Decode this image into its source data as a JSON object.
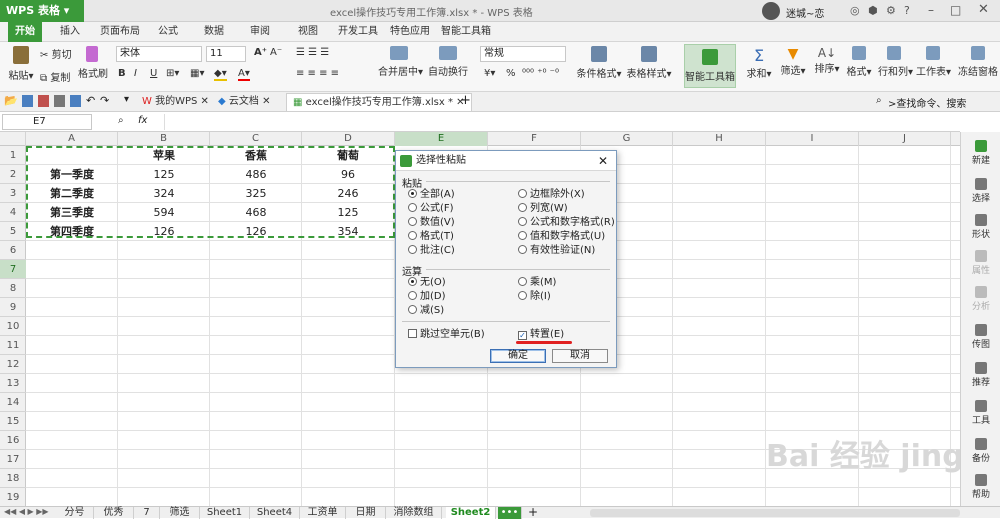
{
  "titlebar": {
    "app_menu": "WPS 表格",
    "window_title": "excel操作技巧专用工作簿.xlsx * - WPS 表格",
    "user": "迷城~恋"
  },
  "ribbon_tabs": [
    "开始",
    "插入",
    "页面布局",
    "公式",
    "数据",
    "审阅",
    "视图",
    "开发工具",
    "特色应用",
    "智能工具箱"
  ],
  "ribbon": {
    "paste": "粘贴",
    "cut": "剪切",
    "copy": "复制",
    "format_painter": "格式刷",
    "font_name": "宋体",
    "font_size": "11",
    "bold": "B",
    "italic": "I",
    "underline": "U",
    "merge_center": "合并居中",
    "wrap": "自动换行",
    "number_format": "常规",
    "percent": "%",
    "conditional_format": "条件格式",
    "table_style": "表格样式",
    "smart_toolbox": "智能工具箱",
    "sum": "求和",
    "filter": "筛选",
    "sort": "排序",
    "format": "格式",
    "row_col": "行和列",
    "worksheet": "工作表",
    "freeze": "冻结窗格"
  },
  "doc_tabs": {
    "my_wps": "我的WPS",
    "cloud": "云文档",
    "file": "excel操作技巧专用工作簿.xlsx *",
    "search": ">查找命令、搜索"
  },
  "formula_bar": {
    "name_box": "E7",
    "fx": "fx"
  },
  "columns": [
    "A",
    "B",
    "C",
    "D",
    "E",
    "F",
    "G",
    "H",
    "I",
    "J"
  ],
  "rows": [
    "1",
    "2",
    "3",
    "4",
    "5",
    "6",
    "7",
    "8",
    "9",
    "10",
    "11",
    "12",
    "13",
    "14",
    "15",
    "16",
    "17",
    "18",
    "19"
  ],
  "cells": {
    "headers": [
      "苹果",
      "香蕉",
      "葡萄"
    ],
    "row_labels": [
      "第一季度",
      "第二季度",
      "第三季度",
      "第四季度"
    ],
    "values": [
      [
        "125",
        "486",
        "96"
      ],
      [
        "324",
        "325",
        "246"
      ],
      [
        "594",
        "468",
        "125"
      ],
      [
        "126",
        "126",
        "354"
      ]
    ]
  },
  "dialog": {
    "title": "选择性粘贴",
    "paste_group": "粘贴",
    "paste_left": [
      "全部(A)",
      "公式(F)",
      "数值(V)",
      "格式(T)",
      "批注(C)"
    ],
    "paste_right": [
      "边框除外(X)",
      "列宽(W)",
      "公式和数字格式(R)",
      "值和数字格式(U)",
      "有效性验证(N)"
    ],
    "op_group": "运算",
    "op_left": [
      "无(O)",
      "加(D)",
      "减(S)"
    ],
    "op_right": [
      "乘(M)",
      "除(I)"
    ],
    "skip_blanks": "跳过空单元(B)",
    "transpose": "转置(E)",
    "transpose_checkmark": "✓",
    "ok": "确定",
    "cancel": "取消"
  },
  "right_panel": [
    "新建",
    "选择",
    "形状",
    "属性",
    "分析",
    "传图",
    "推荐",
    "工具",
    "备份",
    "帮助"
  ],
  "sheet_tabs": [
    "分号",
    "优秀",
    "7",
    "筛选",
    "Sheet1",
    "Sheet4",
    "工资单",
    "日期",
    "消除数组",
    "Sheet2"
  ],
  "sheet_more": "•••",
  "watermark": "Bai 经验  jingyan.baidu.com",
  "colors": {
    "accent": "#3b9a3a",
    "selection": "#c8dfc8",
    "annotation": "#e02020"
  }
}
